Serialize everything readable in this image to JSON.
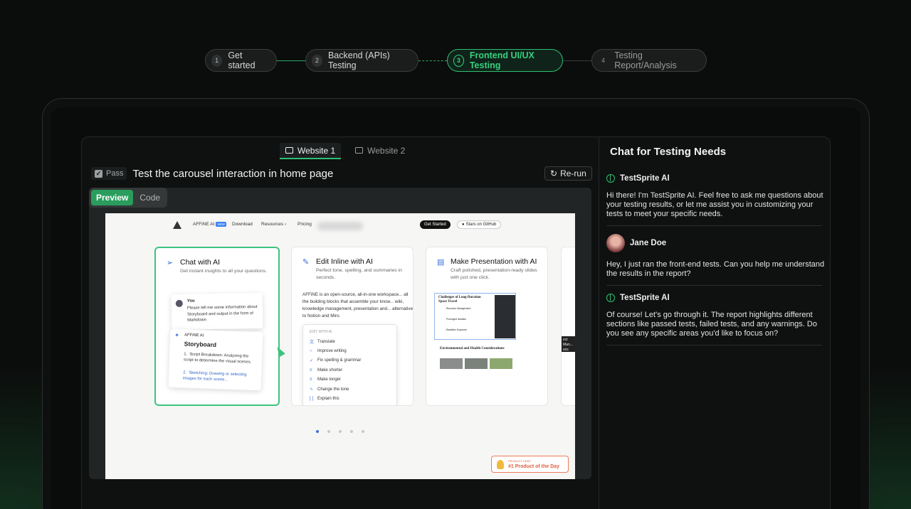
{
  "stepper": {
    "steps": [
      {
        "num": "1",
        "label": "Get started"
      },
      {
        "num": "2",
        "label": "Backend (APIs) Testing"
      },
      {
        "num": "3",
        "label": "Frontend UI/UX Testing"
      },
      {
        "num": "4",
        "label": "Testing Report/Analysis"
      }
    ],
    "active_step": 3
  },
  "tabs": [
    {
      "label": "Website 1"
    },
    {
      "label": "Website 2"
    }
  ],
  "test": {
    "status": "Pass",
    "title": "Test the carousel interaction in home page",
    "rerun_label": "Re-run"
  },
  "view_toggle": {
    "preview": "Preview",
    "code": "Code"
  },
  "site": {
    "nav": {
      "brand": "AFFiNE AI",
      "new_badge": "NEW",
      "download": "Download",
      "resources": "Resources",
      "pricing": "Pricing",
      "get_started": "Get Started",
      "github": "Stars on GitHub"
    },
    "cards": [
      {
        "title": "Chat with AI",
        "sub": "Get instant insights to all your questions."
      },
      {
        "title": "Edit Inline with AI",
        "sub": "Perfect tone, spelling, and summaries in seconds."
      },
      {
        "title": "Make Presentation with AI",
        "sub": "Craft polished, presentation-ready slides with just one click."
      }
    ],
    "chat_card": {
      "you": "You",
      "you_msg": "Please tell me some information about Storyboard and output in the form of Markdown",
      "ai": "AFFiNE AI",
      "ai_title": "Storyboard",
      "item1": "Script Breakdown: Analyzing the script to determine the visual scenes.",
      "item2": "Sketching: Drawing or selecting images for each scene..."
    },
    "edit_card": {
      "text": "AFFiNE is an open-source, all-in-one workspace... all the building blocks that assemble your know... wiki, knowledge management, presentation and... alternative to Notion and Miro.",
      "menu_header": "EDIT WITH AI",
      "menu": [
        "Translate",
        "Improve writing",
        "Fix spelling & grammar",
        "Make shorter",
        "Make longer",
        "Change the tone",
        "Explain this"
      ]
    },
    "pres_card": {
      "slide_title": "Challenges of Long-Duration Space Travel",
      "slide_items": [
        "Resource Management",
        "Prolonged Isolation",
        "Radiation Exposure"
      ],
      "section_title": "Environmental and Health Considerations"
    },
    "peek_text": "ect Man... ess Gro...",
    "carousel": {
      "count": 5,
      "active": 1
    },
    "product_hunt": {
      "small": "PRODUCT HUNT",
      "big": "#1 Product of the Day"
    }
  },
  "chat": {
    "title": "Chat for Testing Needs",
    "messages": [
      {
        "author": "TestSprite AI",
        "text": "Hi there! I'm TestSprite AI. Feel free to ask me questions about your testing results, or let me assist you in customizing your tests to meet your specific needs."
      },
      {
        "author": "Jane Doe",
        "text": "Hey, I just ran the front-end tests. Can you help me understand the results in the report?"
      },
      {
        "author": "TestSprite AI",
        "text": "Of course! Let's go through it. The report highlights different sections like passed tests, failed tests, and any warnings. Do you see any specific areas you'd like to focus on?"
      }
    ]
  },
  "colors": {
    "accent": "#2fbf71",
    "background": "#0b0d0c"
  }
}
